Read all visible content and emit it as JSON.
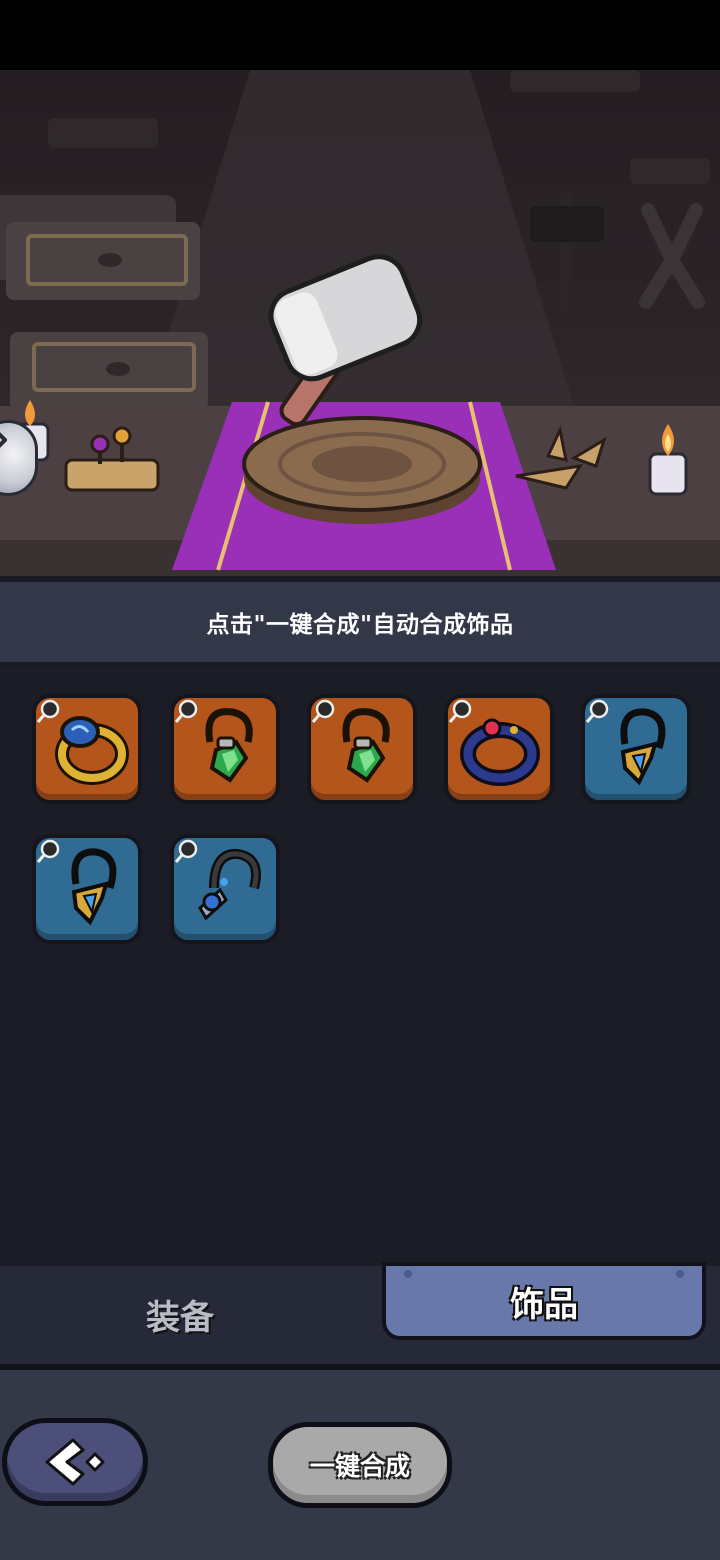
{
  "hint": {
    "text": "点击\"一键合成\"自动合成饰品"
  },
  "tabs": [
    {
      "label": "装备",
      "active": false
    },
    {
      "label": "饰品",
      "active": true
    }
  ],
  "actions": {
    "synthesize_label": "一键合成"
  },
  "items": [
    {
      "icon": "gold-sapphire-ring-icon",
      "rarity_color": "#b4551c"
    },
    {
      "icon": "emerald-pendant-icon",
      "rarity_color": "#b4551c"
    },
    {
      "icon": "emerald-pendant-icon",
      "rarity_color": "#b4551c"
    },
    {
      "icon": "navy-ruby-ring-icon",
      "rarity_color": "#b4551c"
    },
    {
      "icon": "gold-crystal-amulet-icon",
      "rarity_color": "#2f6b93"
    },
    {
      "icon": "gold-crystal-amulet-icon",
      "rarity_color": "#2f6b93"
    },
    {
      "icon": "cord-sapphire-amulet-icon",
      "rarity_color": "#2f6b93"
    }
  ],
  "colors": {
    "tab_active": "#6878ab",
    "hint_bar": "#333848",
    "panel": "#1b1c25",
    "cloth": "#9a2fb8"
  }
}
